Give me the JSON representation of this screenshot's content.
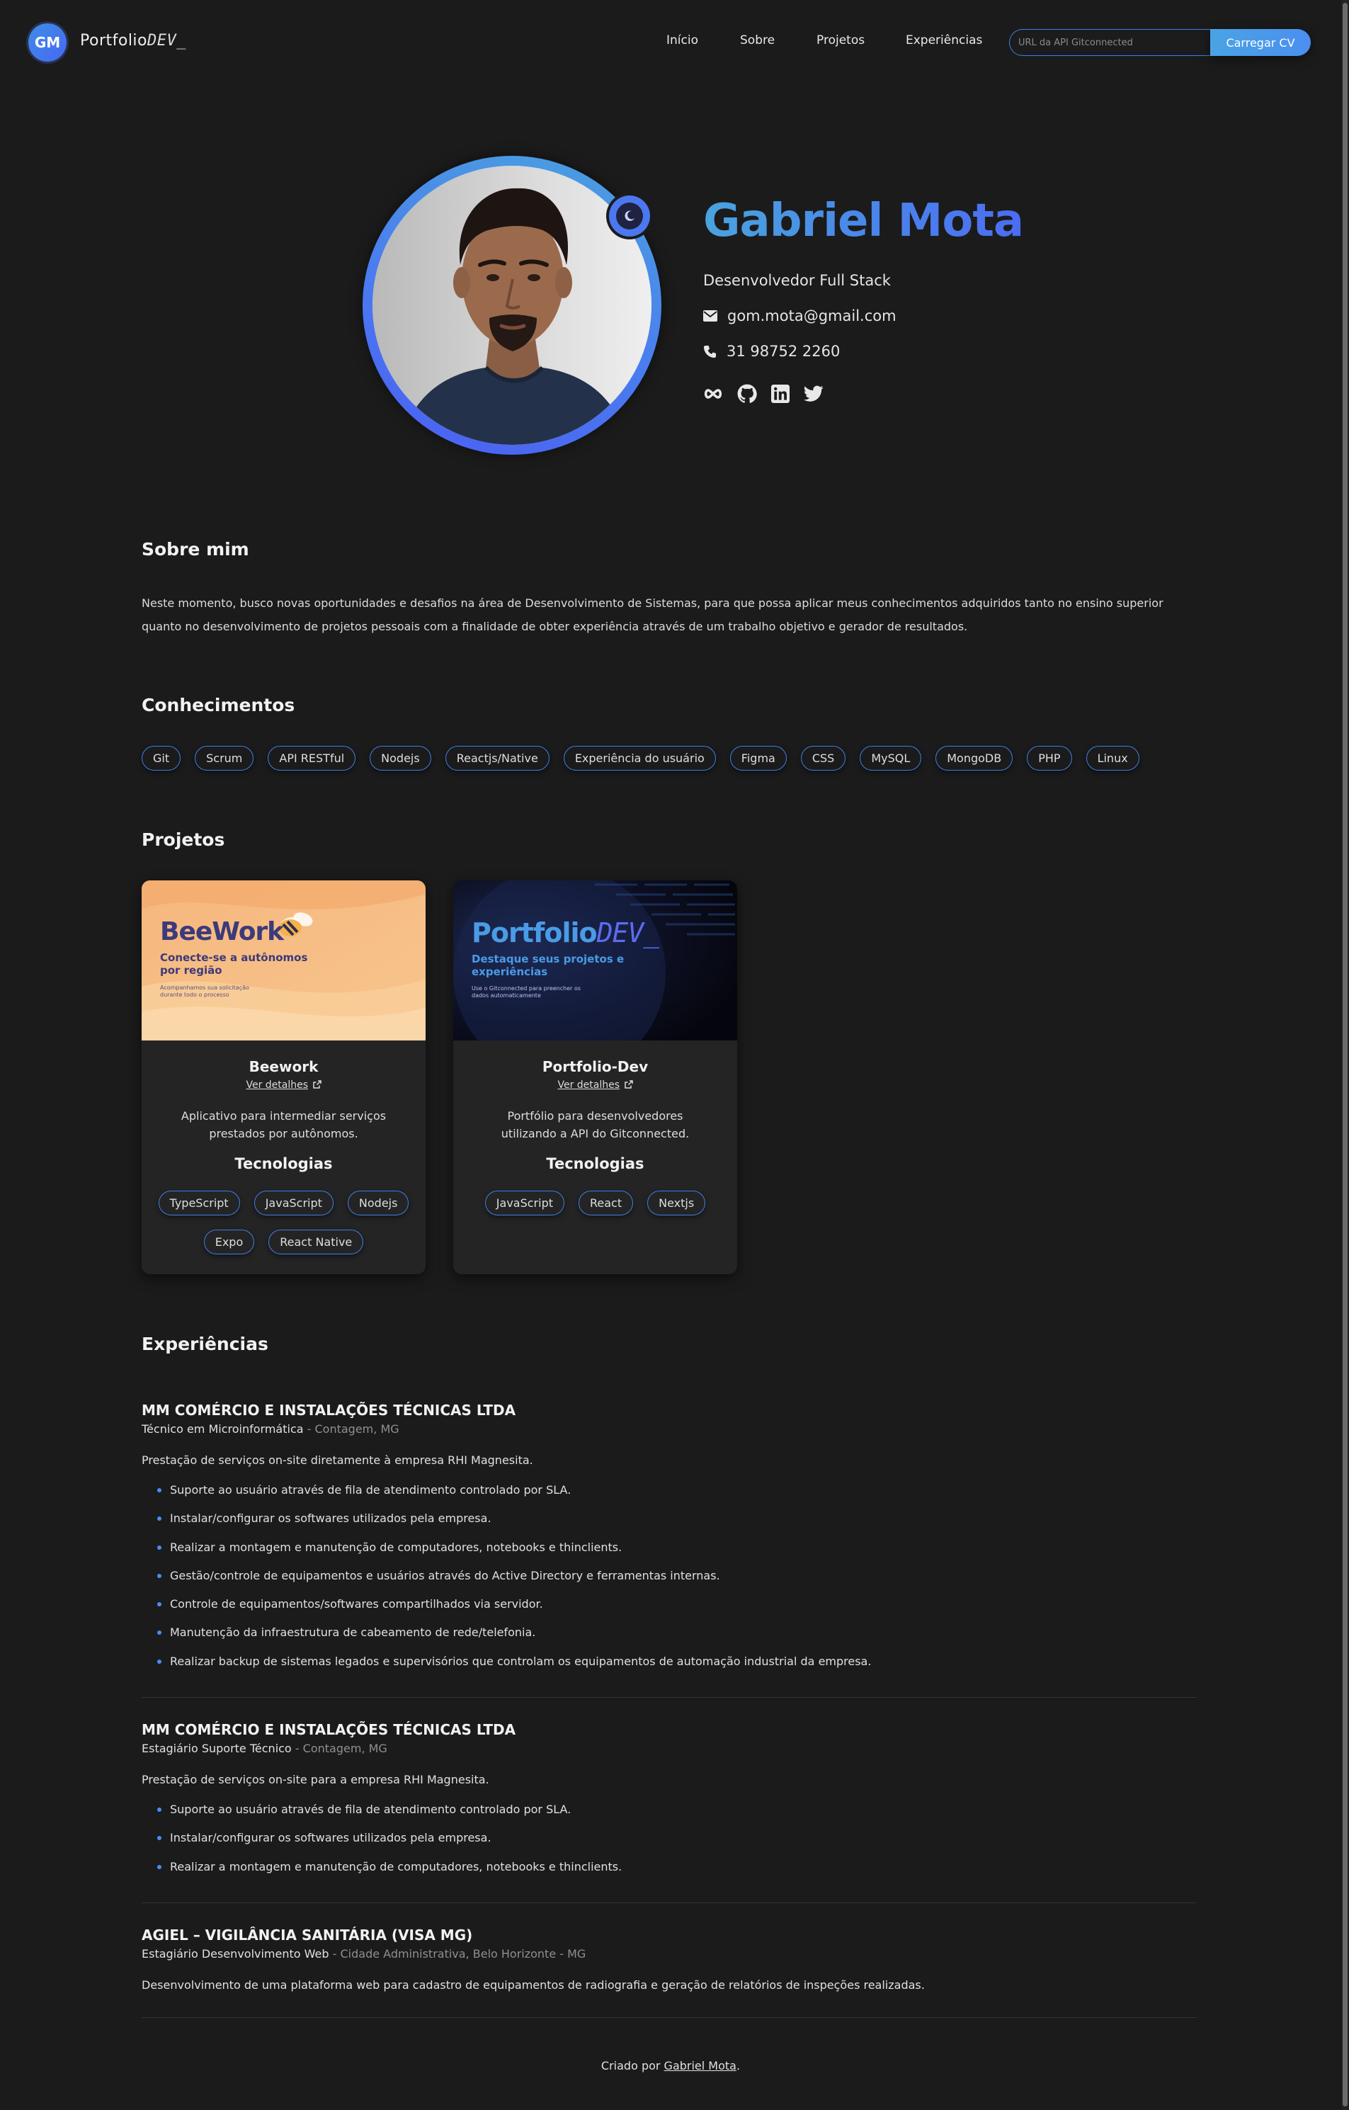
{
  "header": {
    "logo_initials": "GM",
    "logo_text": "Portfolio",
    "logo_dev": "DEV_",
    "nav": [
      "Início",
      "Sobre",
      "Projetos",
      "Experiências"
    ],
    "cv_input_placeholder": "URL da API Gitconnected",
    "cv_button": "Carregar CV"
  },
  "hero": {
    "name": "Gabriel Mota",
    "role": "Desenvolvedor Full Stack",
    "email": "gom.mota@gmail.com",
    "phone": "31 98752 2260",
    "socials": [
      "infinity-icon",
      "github-icon",
      "linkedin-icon",
      "twitter-icon"
    ]
  },
  "about": {
    "title": "Sobre mim",
    "text": "Neste momento, busco novas oportunidades e desafios na área de Desenvolvimento de Sistemas, para que possa aplicar meus conhecimentos adquiridos tanto no ensino superior quanto no desenvolvimento de projetos pessoais com a finalidade de obter experiência através de um trabalho objetivo e gerador de resultados."
  },
  "skills": {
    "title": "Conhecimentos",
    "items": [
      "Git",
      "Scrum",
      "API RESTful",
      "Nodejs",
      "Reactjs/Native",
      "Experiência do usuário",
      "Figma",
      "CSS",
      "MySQL",
      "MongoDB",
      "PHP",
      "Linux"
    ]
  },
  "projects": {
    "title": "Projetos",
    "items": [
      {
        "name": "Beework",
        "link": "Ver detalhes",
        "description": "Aplicativo para intermediar serviços prestados por autônomos.",
        "tech_title": "Tecnologias",
        "tech": [
          "TypeScript",
          "JavaScript",
          "Nodejs",
          "Expo",
          "React Native"
        ],
        "thumb": {
          "brand": "BeeWork",
          "headline_1": "Conecte-se a autônomos",
          "headline_2": "por região",
          "small_1": "Acompanhamos sua solicitação",
          "small_2": "durante todo o processo"
        }
      },
      {
        "name": "Portfolio-Dev",
        "link": "Ver detalhes",
        "description": "Portfólio para desenvolvedores utilizando a API do Gitconnected.",
        "tech_title": "Tecnologias",
        "tech": [
          "JavaScript",
          "React",
          "Nextjs"
        ],
        "thumb": {
          "brand": "Portfolio",
          "brand_dev": "DEV_",
          "headline_1": "Destaque seus projetos e",
          "headline_2": "experiências",
          "small_1": "Use o Gitconnected para preencher os",
          "small_2": "dados automaticamente"
        }
      }
    ]
  },
  "experiences": {
    "title": "Experiências",
    "items": [
      {
        "company": "MM COMÉRCIO E INSTALAÇÕES TÉCNICAS LTDA",
        "role": "Técnico em Microinformática",
        "location": " - Contagem, MG",
        "description": "Prestação de serviços on-site diretamente à empresa RHI Magnesita.",
        "bullets": [
          "Suporte ao usuário através de fila de atendimento controlado por SLA.",
          "Instalar/configurar os softwares utilizados pela empresa.",
          "Realizar a montagem e manutenção de computadores, notebooks e thinclients.",
          "Gestão/controle de equipamentos e usuários através do Active Directory e ferramentas internas.",
          "Controle de equipamentos/softwares compartilhados via servidor.",
          "Manutenção da infraestrutura de cabeamento de rede/telefonia.",
          "Realizar backup de sistemas legados e supervisórios que controlam os equipamentos de automação industrial da empresa."
        ]
      },
      {
        "company": "MM COMÉRCIO E INSTALAÇÕES TÉCNICAS LTDA",
        "role": "Estagiário Suporte Técnico",
        "location": " - Contagem, MG",
        "description": "Prestação de serviços on-site para a empresa RHI Magnesita.",
        "bullets": [
          "Suporte ao usuário através de fila de atendimento controlado por SLA.",
          "Instalar/configurar os softwares utilizados pela empresa.",
          "Realizar a montagem e manutenção de computadores, notebooks e thinclients."
        ]
      },
      {
        "company": "AGIEL – VIGILÂNCIA SANITÁRIA (VISA MG)",
        "role": "Estagiário Desenvolvimento Web",
        "location": " - Cidade Administrativa, Belo Horizonte - MG",
        "description": "Desenvolvimento de uma plataforma web para cadastro de equipamentos de radiografia e geração de relatórios de inspeções realizadas.",
        "bullets": []
      }
    ]
  },
  "footer": {
    "prefix": "Criado por ",
    "author": "Gabriel Mota",
    "suffix": "."
  },
  "colors": {
    "background": "#1b1b1c",
    "accent_blue": "#4b8ff0",
    "accent_cyan": "#4aa3df",
    "card": "#242425"
  }
}
